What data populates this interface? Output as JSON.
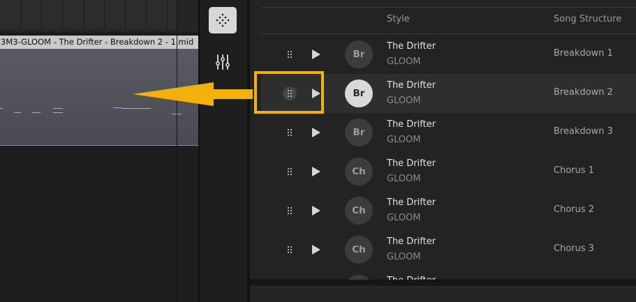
{
  "daw": {
    "clip_title": "3M3-GLOOM - The Drifter - Breakdown 2 - 1.mid"
  },
  "tools": [
    {
      "name": "dots-pattern-icon",
      "active": true
    },
    {
      "name": "mixer-sliders-icon",
      "active": false
    }
  ],
  "columns": {
    "style": "Style",
    "structure": "Song Structure"
  },
  "rows": [
    {
      "avatar": "Br",
      "style": "The Drifter",
      "genre": "GLOOM",
      "structure": "Breakdown 1",
      "selected": false
    },
    {
      "avatar": "Br",
      "style": "The Drifter",
      "genre": "GLOOM",
      "structure": "Breakdown 2",
      "selected": true
    },
    {
      "avatar": "Br",
      "style": "The Drifter",
      "genre": "GLOOM",
      "structure": "Breakdown 3",
      "selected": false
    },
    {
      "avatar": "Ch",
      "style": "The Drifter",
      "genre": "GLOOM",
      "structure": "Chorus 1",
      "selected": false
    },
    {
      "avatar": "Ch",
      "style": "The Drifter",
      "genre": "GLOOM",
      "structure": "Chorus 2",
      "selected": false
    },
    {
      "avatar": "Ch",
      "style": "The Drifter",
      "genre": "GLOOM",
      "structure": "Chorus 3",
      "selected": false
    },
    {
      "avatar": "",
      "style": "The Drifter",
      "genre": "",
      "structure": "",
      "selected": false
    }
  ],
  "colors": {
    "accent": "#f2b10b",
    "selected_row": "#2e2e2e",
    "midi_note": "#a7a5ff"
  }
}
